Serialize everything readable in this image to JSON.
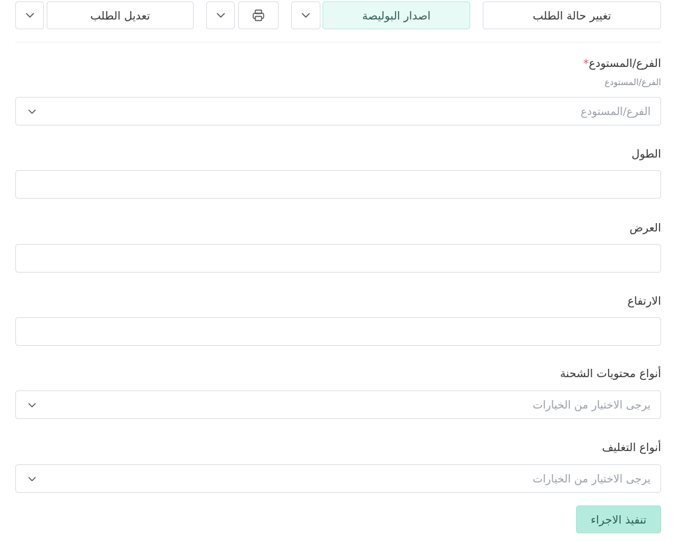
{
  "toolbar": {
    "change_status_label": "تغيير حالة الطلب",
    "issue_policy_label": "اصدار البوليصة",
    "edit_order_label": "تعديل الطلب"
  },
  "form": {
    "branch": {
      "label": "الفرع/المستودع",
      "required_mark": "*",
      "hint": "الفرع/المستودع",
      "placeholder": "الفرع/المستودع"
    },
    "length": {
      "label": "الطول",
      "value": ""
    },
    "width": {
      "label": "العرض",
      "value": ""
    },
    "height": {
      "label": "الارتفاع",
      "value": ""
    },
    "content_types": {
      "label": "أنواع محتويات الشحنة",
      "placeholder": "يرجى الاختيار من الخيارات"
    },
    "packaging_types": {
      "label": "أنواع التغليف",
      "placeholder": "يرجى الاختيار من الخيارات"
    }
  },
  "submit": {
    "label": "تنفيذ الاجراء"
  },
  "icons": {
    "chevron": "chevron-down-icon",
    "print": "printer-icon"
  },
  "colors": {
    "primary_soft": "#e8faf6",
    "submit_bg": "#b3ecde",
    "required": "#f0506e",
    "border": "#dcdfe6"
  }
}
